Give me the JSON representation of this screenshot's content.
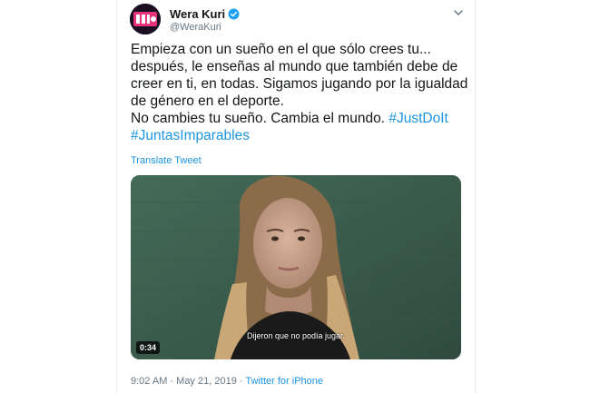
{
  "tweet": {
    "author_name": "Wera Kuri",
    "author_handle": "@WeraKuri",
    "verified_icon": "verified-badge-icon",
    "menu_icon": "chevron-down-icon",
    "text_lines": [
      "Empieza con un sueño en el que sólo crees tu...",
      "después, le enseñas al mundo que también debe de",
      "creer en ti, en todas. Sigamos jugando por la igualdad",
      "de género en el deporte.",
      "No cambies tu sueño. Cambia el mundo."
    ],
    "hashtags": [
      "#JustDoIt",
      "#JuntasImparables"
    ],
    "translate_label": "Translate Tweet",
    "video": {
      "subtitle": "Dijeron que no podía jugar.",
      "duration": "0:34"
    },
    "time": "9:02 AM",
    "date": "May 21, 2019",
    "separator": "·",
    "source": "Twitter for iPhone"
  },
  "colors": {
    "link": "#1b95e0",
    "text": "#14171a",
    "secondary": "#657786"
  }
}
